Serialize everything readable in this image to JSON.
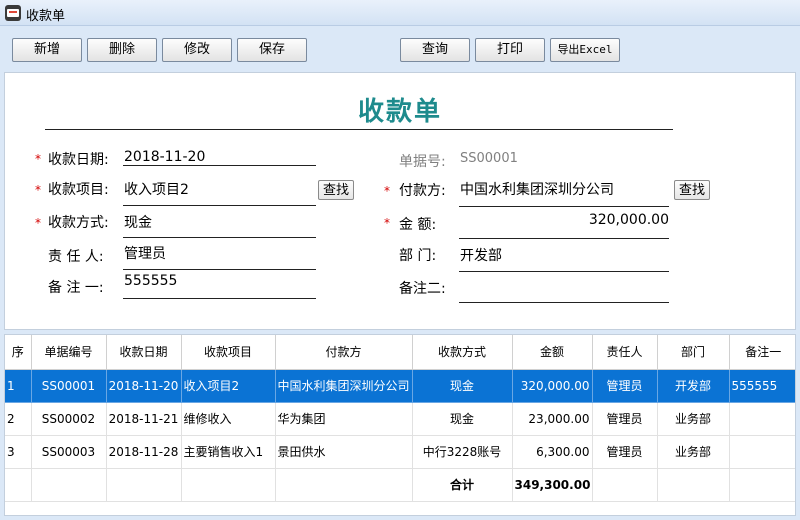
{
  "window": {
    "title": "收款单"
  },
  "toolbar": {
    "add": "新增",
    "delete": "删除",
    "edit": "修改",
    "save": "保存",
    "query": "查询",
    "print": "打印",
    "export": "导出Excel"
  },
  "form": {
    "title": "收款单",
    "date": {
      "label": "收款日期:",
      "value": "2018-11-20"
    },
    "item": {
      "label": "收款项目:",
      "value": "收入项目2"
    },
    "method": {
      "label": "收款方式:",
      "value": "现金"
    },
    "owner": {
      "label": "责 任 人:",
      "value": "管理员"
    },
    "note1": {
      "label": "备 注 一:",
      "value": "555555"
    },
    "doc_no": {
      "label": "单据号:",
      "value": "SS00001"
    },
    "payer": {
      "label": "付款方:",
      "value": "中国水利集团深圳分公司"
    },
    "amount": {
      "label": "金 额:",
      "value": "320,000.00"
    },
    "dept": {
      "label": "部 门:",
      "value": "开发部"
    },
    "note2": {
      "label": "备注二:",
      "value": ""
    },
    "find_label": "查找",
    "required_mark": "*"
  },
  "grid": {
    "headers": [
      "序",
      "单据编号",
      "收款日期",
      "收款项目",
      "付款方",
      "收款方式",
      "金额",
      "责任人",
      "部门",
      "备注一"
    ],
    "rows": [
      [
        "1",
        "SS00001",
        "2018-11-20",
        "收入项目2",
        "中国水利集团深圳分公司",
        "现金",
        "320,000.00",
        "管理员",
        "开发部",
        "555555"
      ],
      [
        "2",
        "SS00002",
        "2018-11-21",
        "维修收入",
        "华为集团",
        "现金",
        "23,000.00",
        "管理员",
        "业务部",
        ""
      ],
      [
        "3",
        "SS00003",
        "2018-11-28",
        "主要销售收入1",
        "景田供水",
        "中行3228账号",
        "6,300.00",
        "管理员",
        "业务部",
        ""
      ]
    ],
    "total_label": "合计",
    "total_value": "349,300.00",
    "selected_row_color": "#0b73d4"
  }
}
